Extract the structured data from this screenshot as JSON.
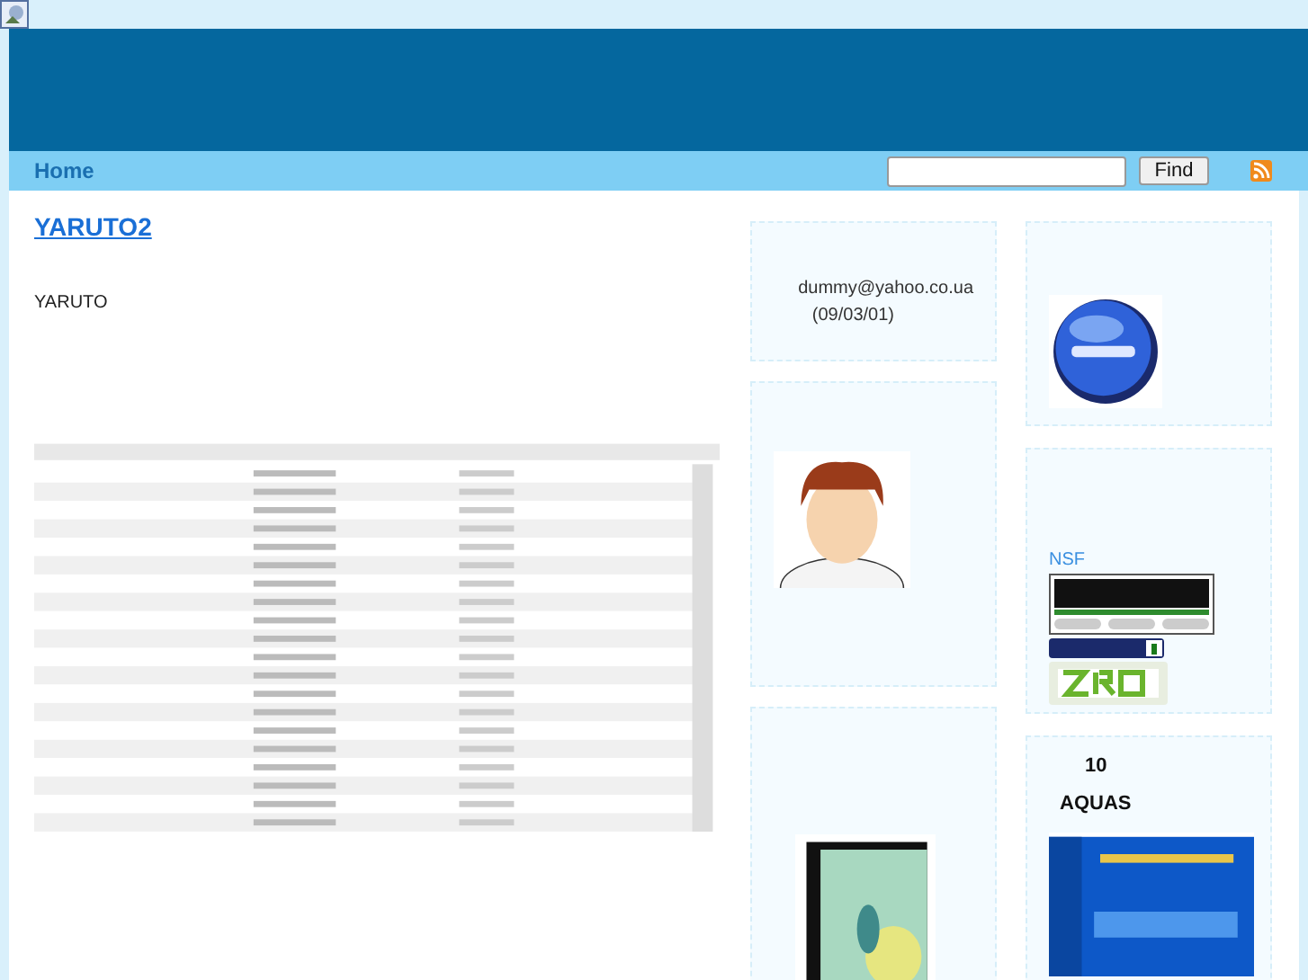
{
  "nav": {
    "home": "Home",
    "search": {
      "button": "Find"
    }
  },
  "post": {
    "title": "YARUTO2",
    "body": "YARUTO",
    "image": {
      "kind": "picture"
    }
  },
  "sidebar_left": [
    {
      "kind": "text",
      "lines": [
        "dummy@yahoo.co.ua",
        "(09/03/01)"
      ]
    },
    {
      "kind": "picture"
    },
    {
      "kind": "picture"
    }
  ],
  "sidebar_right": [
    {
      "kind": "picture"
    },
    {
      "kind": "links",
      "label": "NSF"
    },
    {
      "kind": "promo",
      "lines": [
        "10",
        "AQUAS"
      ]
    }
  ]
}
